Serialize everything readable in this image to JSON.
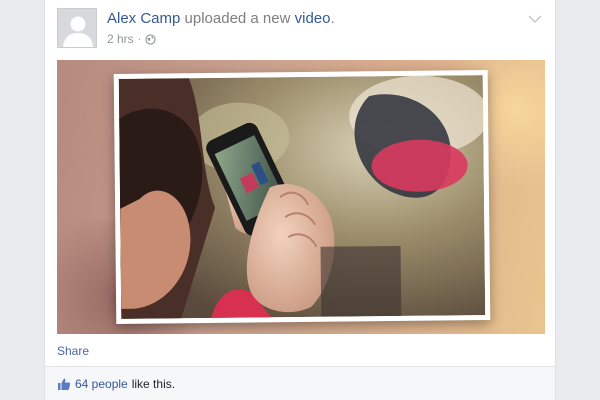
{
  "post": {
    "author": "Alex Camp",
    "action_text": " uploaded a new ",
    "object_link": "video",
    "period": ".",
    "timestamp": "2 hrs",
    "separator": "·",
    "privacy_icon": "globe-icon",
    "menu_icon": "chevron-down-icon"
  },
  "actions": {
    "share_label": "Share"
  },
  "likes": {
    "icon": "thumbs-up-icon",
    "people_link": "64 people",
    "suffix": " like this."
  },
  "colors": {
    "link": "#365899",
    "muted": "#90949c",
    "page_bg": "#e9ebee"
  }
}
